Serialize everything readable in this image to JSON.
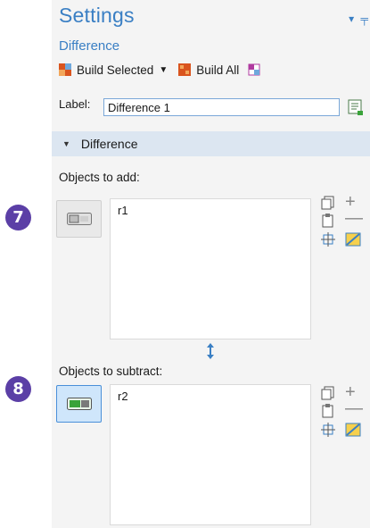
{
  "settings": {
    "title": "Settings",
    "subtitle": "Difference"
  },
  "toolbar": {
    "build_selected_label": "Build Selected",
    "build_all_label": "Build All"
  },
  "label_field": {
    "caption": "Label:",
    "value": "Difference 1"
  },
  "section": {
    "title": "Difference"
  },
  "add_group": {
    "caption": "Objects to add:",
    "items": [
      "r1"
    ],
    "badge": "7"
  },
  "subtract_group": {
    "caption": "Objects to subtract:",
    "items": [
      "r2"
    ],
    "badge": "8"
  },
  "colors": {
    "accent": "#3a7fc4",
    "badge": "#5b3fa6",
    "section_bg": "#dce6f1",
    "active_toggle": "#cfe6fb",
    "toggle_on": "#3aa33a"
  }
}
